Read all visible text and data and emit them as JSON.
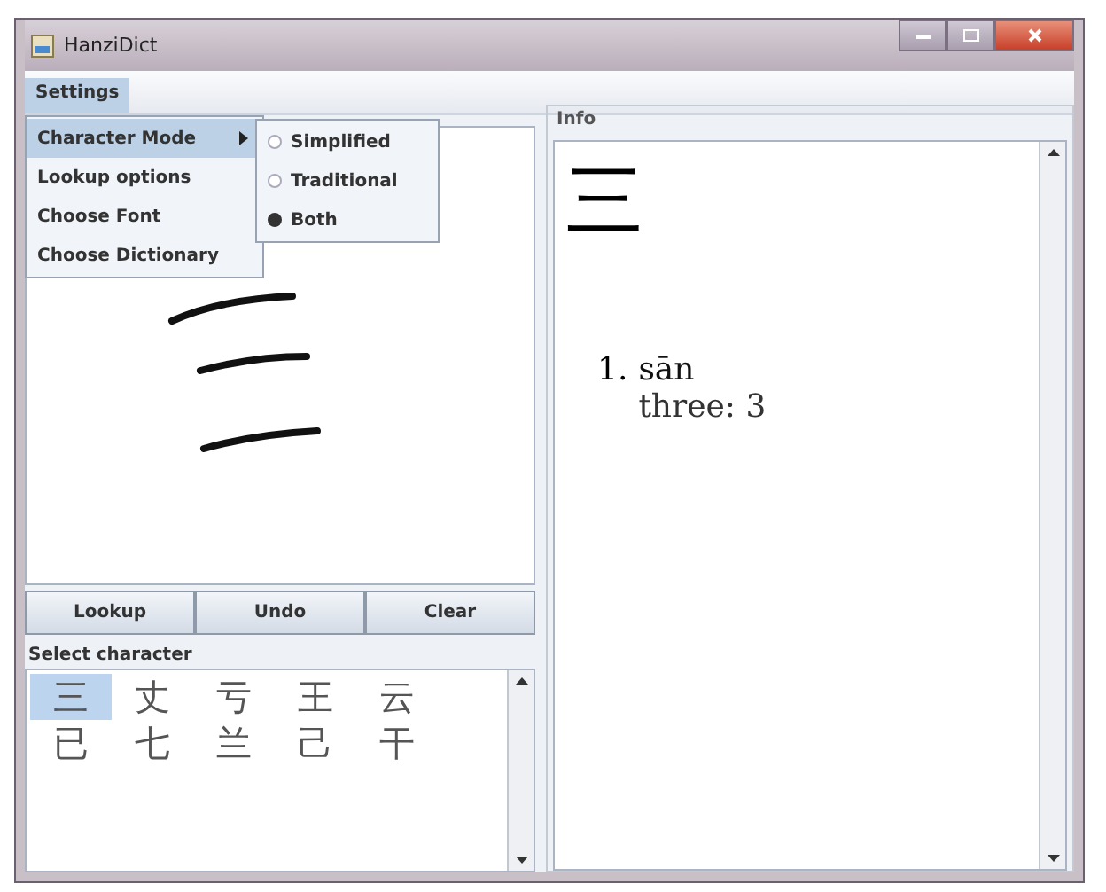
{
  "window": {
    "title": "HanziDict"
  },
  "menu_bar": [
    {
      "label": "Settings",
      "selected": true
    }
  ],
  "settings_menu": [
    {
      "label": "Character Mode",
      "kind": "submenu",
      "selected": true
    },
    {
      "label": "Lookup options",
      "kind": "item",
      "selected": false
    },
    {
      "label": "Choose Font",
      "kind": "item",
      "selected": false
    },
    {
      "label": "Choose Dictionary",
      "kind": "item",
      "selected": false
    }
  ],
  "character_mode_submenu": [
    {
      "label": "Simplified",
      "selected": false
    },
    {
      "label": "Traditional",
      "selected": false
    },
    {
      "label": "Both",
      "selected": true
    }
  ],
  "buttons": [
    "Lookup",
    "Undo",
    "Clear"
  ],
  "candidates": {
    "label": "Select character",
    "items": [
      {
        "char": "三",
        "selected": true
      },
      {
        "char": "丈",
        "selected": false
      },
      {
        "char": "亏",
        "selected": false
      },
      {
        "char": "王",
        "selected": false
      },
      {
        "char": "云",
        "selected": false
      },
      {
        "char": "已",
        "selected": false
      },
      {
        "char": "七",
        "selected": false
      },
      {
        "char": "兰",
        "selected": false
      },
      {
        "char": "己",
        "selected": false
      },
      {
        "char": "干",
        "selected": false
      }
    ]
  },
  "info": {
    "title": "Info",
    "character": "三",
    "entries": [
      {
        "number": "1.",
        "pinyin": "sān",
        "definition": "three: 3"
      }
    ]
  }
}
